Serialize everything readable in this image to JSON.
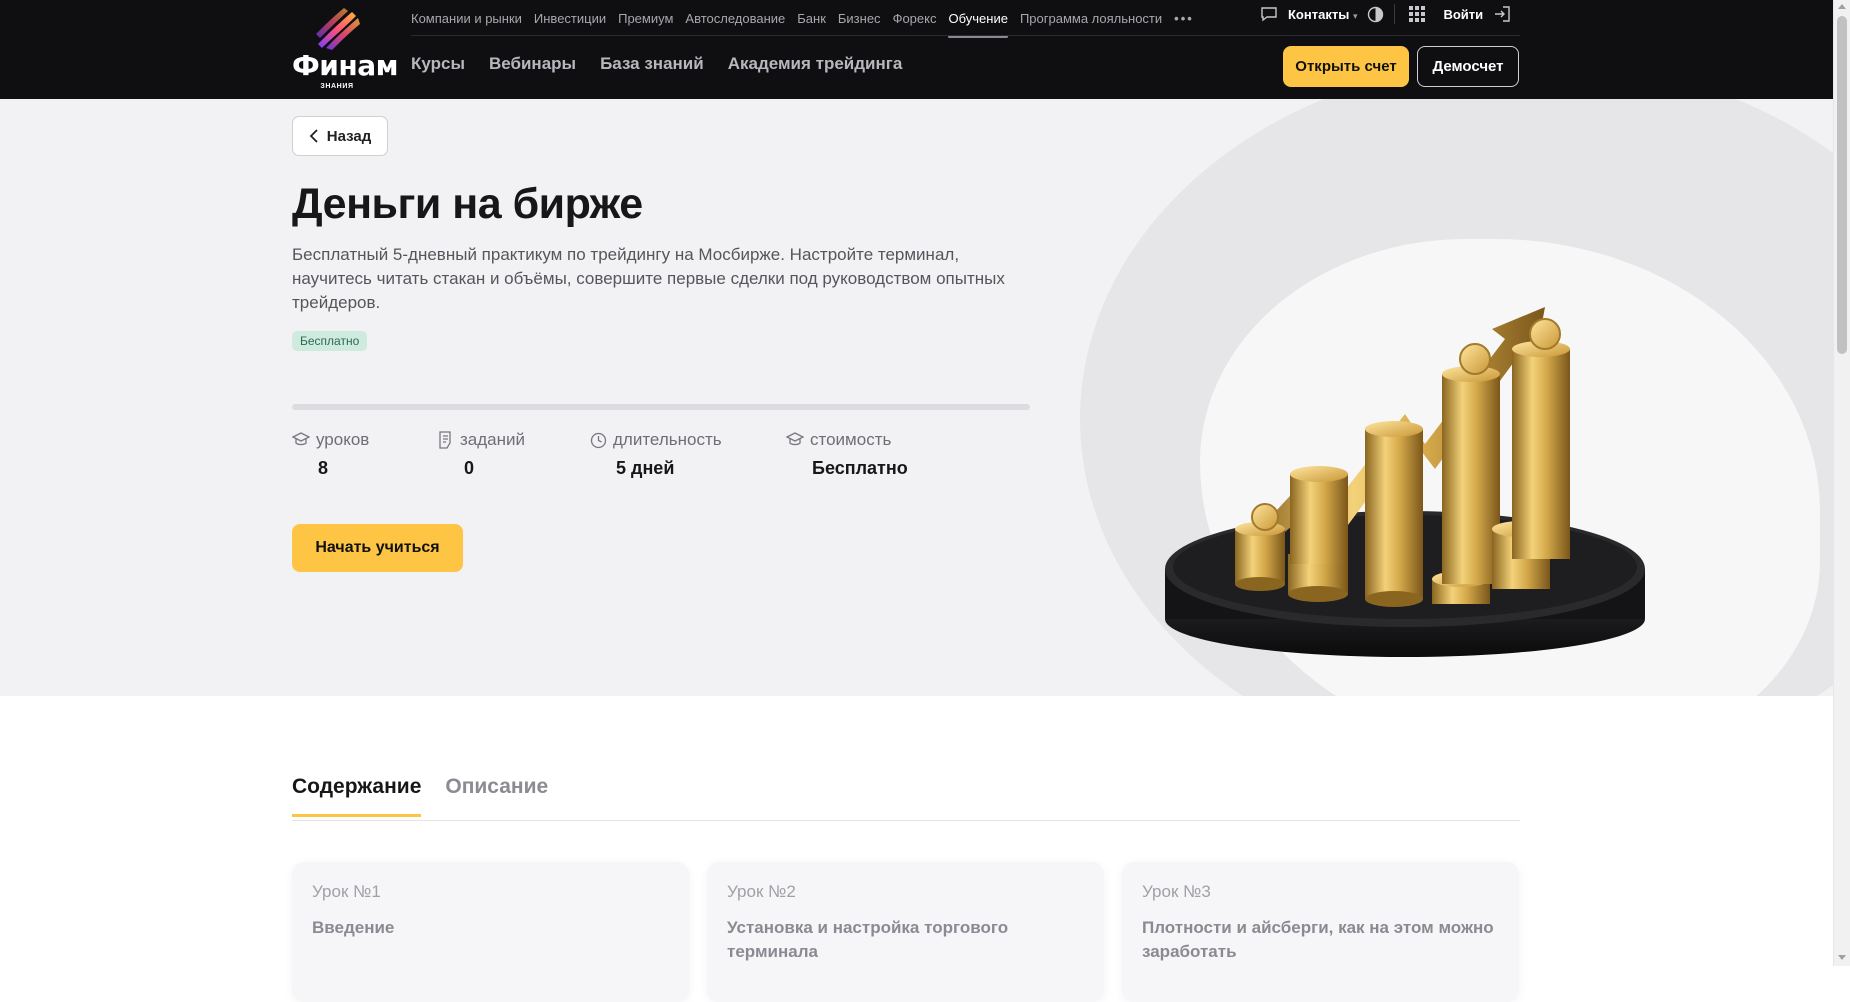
{
  "brand": {
    "name": "Финам",
    "sub": "ЗНАНИЯ"
  },
  "top_nav": [
    "Компании и рынки",
    "Инвестиции",
    "Премиум",
    "Автоследование",
    "Банк",
    "Бизнес",
    "Форекс",
    "Обучение",
    "Программа лояльности"
  ],
  "top_nav_active": "Обучение",
  "main_nav": [
    "Курсы",
    "Вебинары",
    "База знаний",
    "Академия трейдинга"
  ],
  "header_right": {
    "contacts": "Контакты",
    "login": "Войти",
    "open_account": "Открыть счет",
    "demo": "Демосчет"
  },
  "back_label": "Назад",
  "course": {
    "title": "Деньги на бирже",
    "description": "Бесплатный 5-дневный практикум по трейдингу на Мосбирже. Настройте терминал, научитесь читать стакан и объёмы, совершите первые сделки под руководством опытных трейдеров.",
    "badge": "Бесплатно",
    "stats": [
      {
        "label": "уроков",
        "value": "8",
        "icon": "graduation-cap-icon"
      },
      {
        "label": "заданий",
        "value": "0",
        "icon": "task-list-icon"
      },
      {
        "label": "длительность",
        "value": "5 дней",
        "icon": "clock-icon"
      },
      {
        "label": "стоимость",
        "value": "Бесплатно",
        "icon": "graduation-cap-icon"
      }
    ],
    "start_label": "Начать учиться"
  },
  "tabs": [
    {
      "label": "Содержание",
      "active": true
    },
    {
      "label": "Описание",
      "active": false
    }
  ],
  "lessons": [
    {
      "num": "Урок №1",
      "title": "Введение"
    },
    {
      "num": "Урок №2",
      "title": "Установка и настройка торгового терминала"
    },
    {
      "num": "Урок №3",
      "title": "Плотности и айсберги, как на этом можно заработать"
    }
  ],
  "colors": {
    "accent": "#fdc543",
    "header_bg": "#0f0f12",
    "badge_bg": "#cfeade"
  }
}
